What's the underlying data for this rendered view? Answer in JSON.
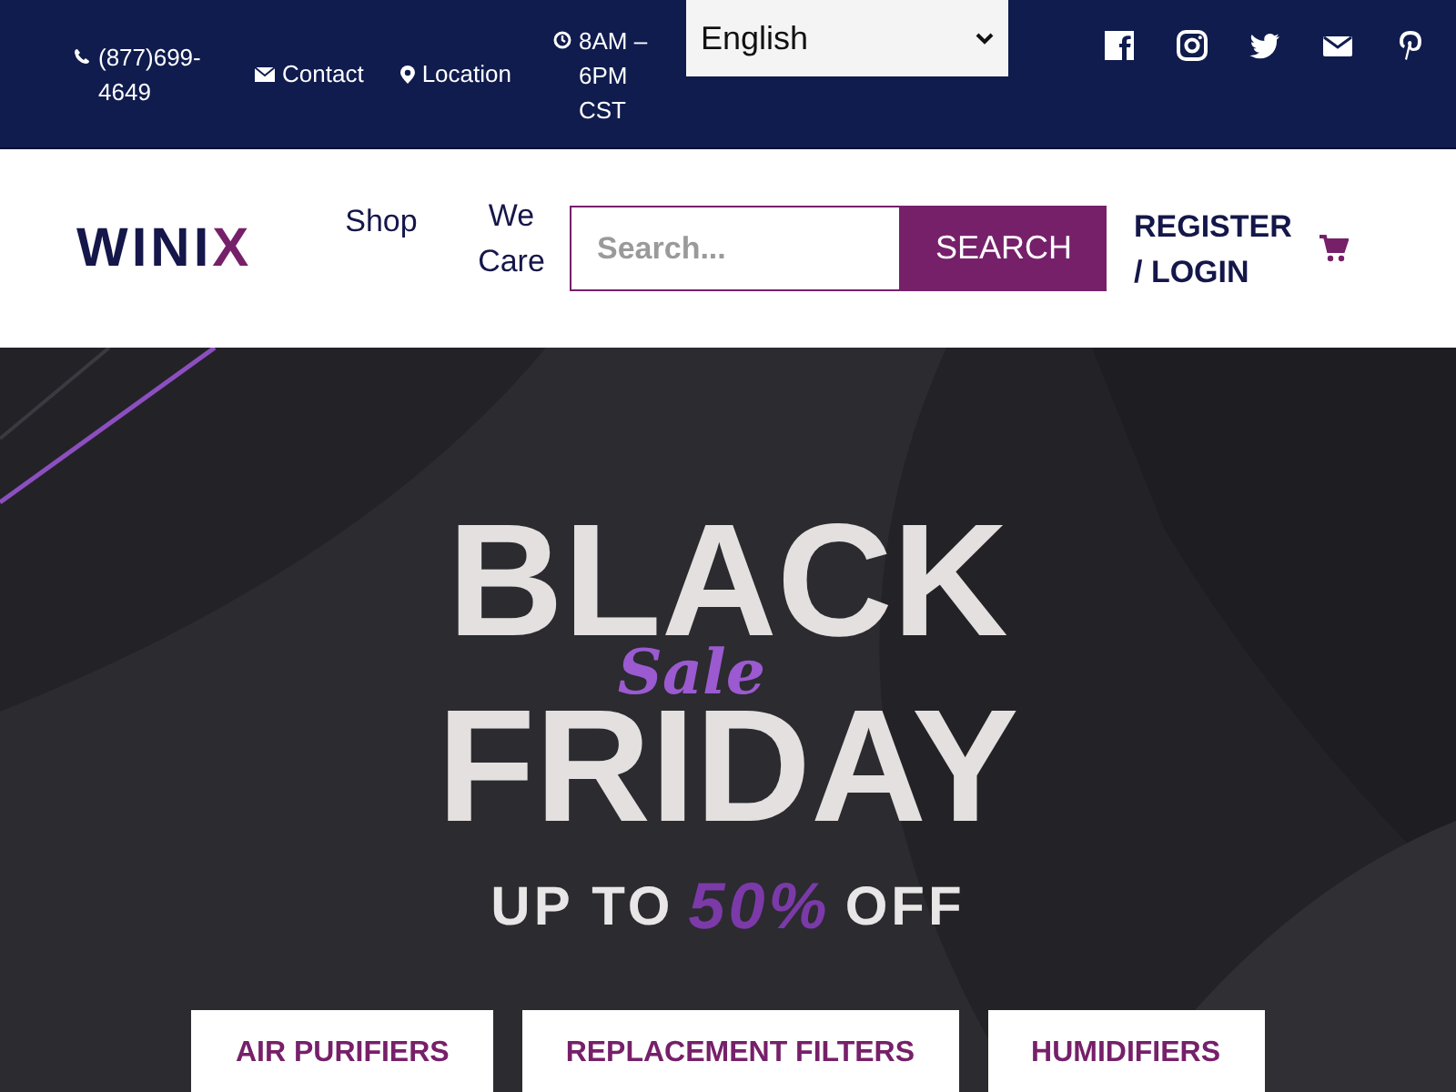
{
  "topbar": {
    "phone": "(877)699-4649",
    "contact": "Contact",
    "location": "Location",
    "hours": "8AM – 6PM CST",
    "language": {
      "value": "English"
    },
    "social": [
      {
        "kind": "facebook"
      },
      {
        "kind": "instagram"
      },
      {
        "kind": "twitter"
      },
      {
        "kind": "email"
      },
      {
        "kind": "pinterest"
      }
    ]
  },
  "header": {
    "logo": "WINIX",
    "nav": [
      "Shop",
      "We Care"
    ],
    "search": {
      "placeholder": "Search...",
      "button": "SEARCH"
    },
    "account": "REGISTER / LOGIN"
  },
  "hero": {
    "line1": "BLACK",
    "script": "Sale",
    "line2": "FRIDAY",
    "offer_prefix": "UP TO",
    "offer_amount": "50%",
    "offer_suffix": "OFF",
    "buttons": [
      "AIR PURIFIERS",
      "REPLACEMENT FILTERS",
      "HUMIDIFIERS"
    ]
  }
}
